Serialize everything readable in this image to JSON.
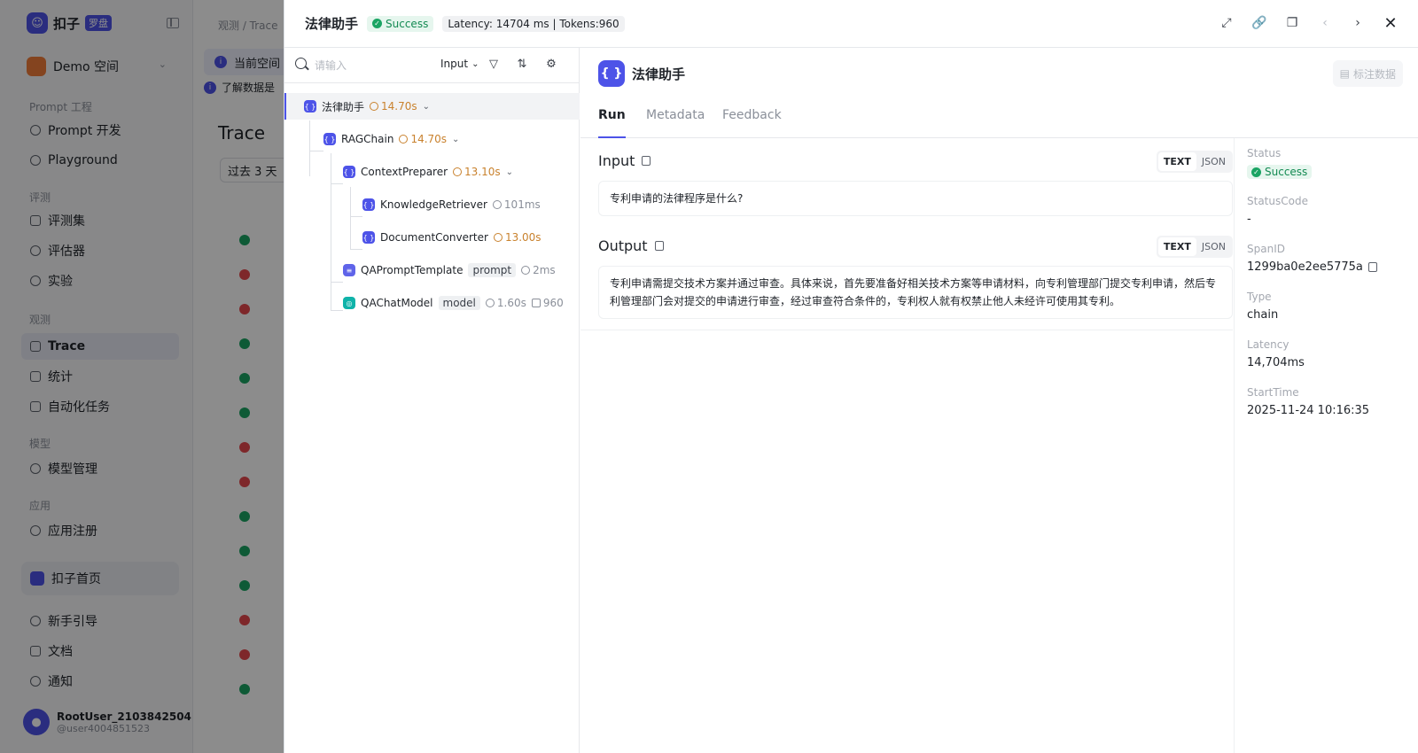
{
  "sidebar": {
    "brand": "扣子",
    "brand_badge": "罗盘",
    "space": "Demo 空间",
    "groups": [
      {
        "label": "Prompt 工程"
      },
      {
        "label": "评测"
      },
      {
        "label": "观测"
      },
      {
        "label": "模型"
      },
      {
        "label": "应用"
      }
    ],
    "items": [
      {
        "label": "Prompt 开发"
      },
      {
        "label": "Playground"
      },
      {
        "label": "评测集"
      },
      {
        "label": "评估器"
      },
      {
        "label": "实验"
      },
      {
        "label": "Trace"
      },
      {
        "label": "统计"
      },
      {
        "label": "自动化任务"
      },
      {
        "label": "模型管理"
      },
      {
        "label": "应用注册"
      }
    ],
    "home": "扣子首页",
    "footer_items": [
      {
        "label": "新手引导"
      },
      {
        "label": "文档"
      },
      {
        "label": "通知"
      }
    ],
    "user": {
      "name": "RootUser_2103842504",
      "handle": "@user4004851523"
    }
  },
  "background": {
    "breadcrumb": "观测 / Trace",
    "notice_1": "当前空间",
    "notice_2": "了解数据是",
    "page_title": "Trace",
    "time_range": "过去 3 天"
  },
  "drawer": {
    "title": "法律助手",
    "status": "Success",
    "stats": "Latency: 14704 ms | Tokens:960",
    "tree": {
      "search_placeholder": "请输入",
      "field_select": "Input",
      "nodes": [
        {
          "name": "法律助手",
          "latency": "14.70s"
        },
        {
          "name": "RAGChain",
          "latency": "14.70s"
        },
        {
          "name": "ContextPreparer",
          "latency": "13.10s"
        },
        {
          "name": "KnowledgeRetriever",
          "latency": "101ms"
        },
        {
          "name": "DocumentConverter",
          "latency": "13.00s"
        },
        {
          "name": "QAPromptTemplate",
          "type": "prompt",
          "latency": "2ms"
        },
        {
          "name": "QAChatModel",
          "type": "model",
          "latency": "1.60s",
          "tokens": "960"
        }
      ]
    },
    "detail": {
      "title": "法律助手",
      "annotate_button": "标注数据",
      "tabs": [
        {
          "label": "Run"
        },
        {
          "label": "Metadata"
        },
        {
          "label": "Feedback"
        }
      ],
      "input": {
        "label": "Input",
        "format_text": "TEXT",
        "format_json": "JSON",
        "value": "专利申请的法律程序是什么?"
      },
      "output": {
        "label": "Output",
        "format_text": "TEXT",
        "format_json": "JSON",
        "value": "专利申请需提交技术方案并通过审查。具体来说，首先要准备好相关技术方案等申请材料，向专利管理部门提交专利申请，然后专利管理部门会对提交的申请进行审查，经过审查符合条件的，专利权人就有权禁止他人未经许可使用其专利。"
      },
      "meta": {
        "status_label": "Status",
        "status_value": "Success",
        "status_code_label": "StatusCode",
        "status_code_value": "-",
        "span_id_label": "SpanID",
        "span_id_value": "1299ba0e2ee5775a",
        "type_label": "Type",
        "type_value": "chain",
        "latency_label": "Latency",
        "latency_value": "14,704ms",
        "start_time_label": "StartTime",
        "start_time_value": "2025-11-24 10:16:35"
      }
    }
  },
  "colors": {
    "accent": "#4d53e8",
    "success": "#1aa463",
    "error": "#e5484d",
    "latency": "#c9822e"
  }
}
